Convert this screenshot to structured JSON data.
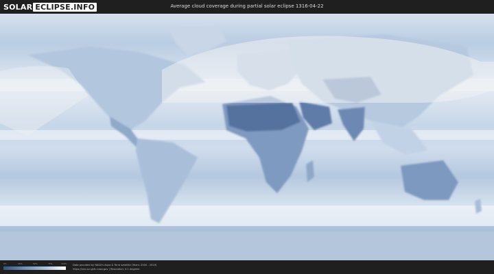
{
  "header": {
    "logo_part1": "SOLAR",
    "logo_part2": "ECLIPSE.INFO",
    "title": "Average cloud coverage during partial solar eclipse 1316-04-22"
  },
  "map": {
    "type": "world cloud coverage map",
    "colors": {
      "clear_sky": "#35557f",
      "overcast": "#ffffff",
      "eclipse_visibility_overlay": "#e8ecef"
    }
  },
  "footer": {
    "scale_ticks": [
      "0%",
      "25%",
      "50%",
      "75%",
      "100%"
    ],
    "source_line": "Data provided by NASA's Aqua & Terra satellite (Years: 2000 - 2019)",
    "url_line": "https://neo.sci.gsfc.nasa.gov | Resolution: 0.1 degrees"
  }
}
